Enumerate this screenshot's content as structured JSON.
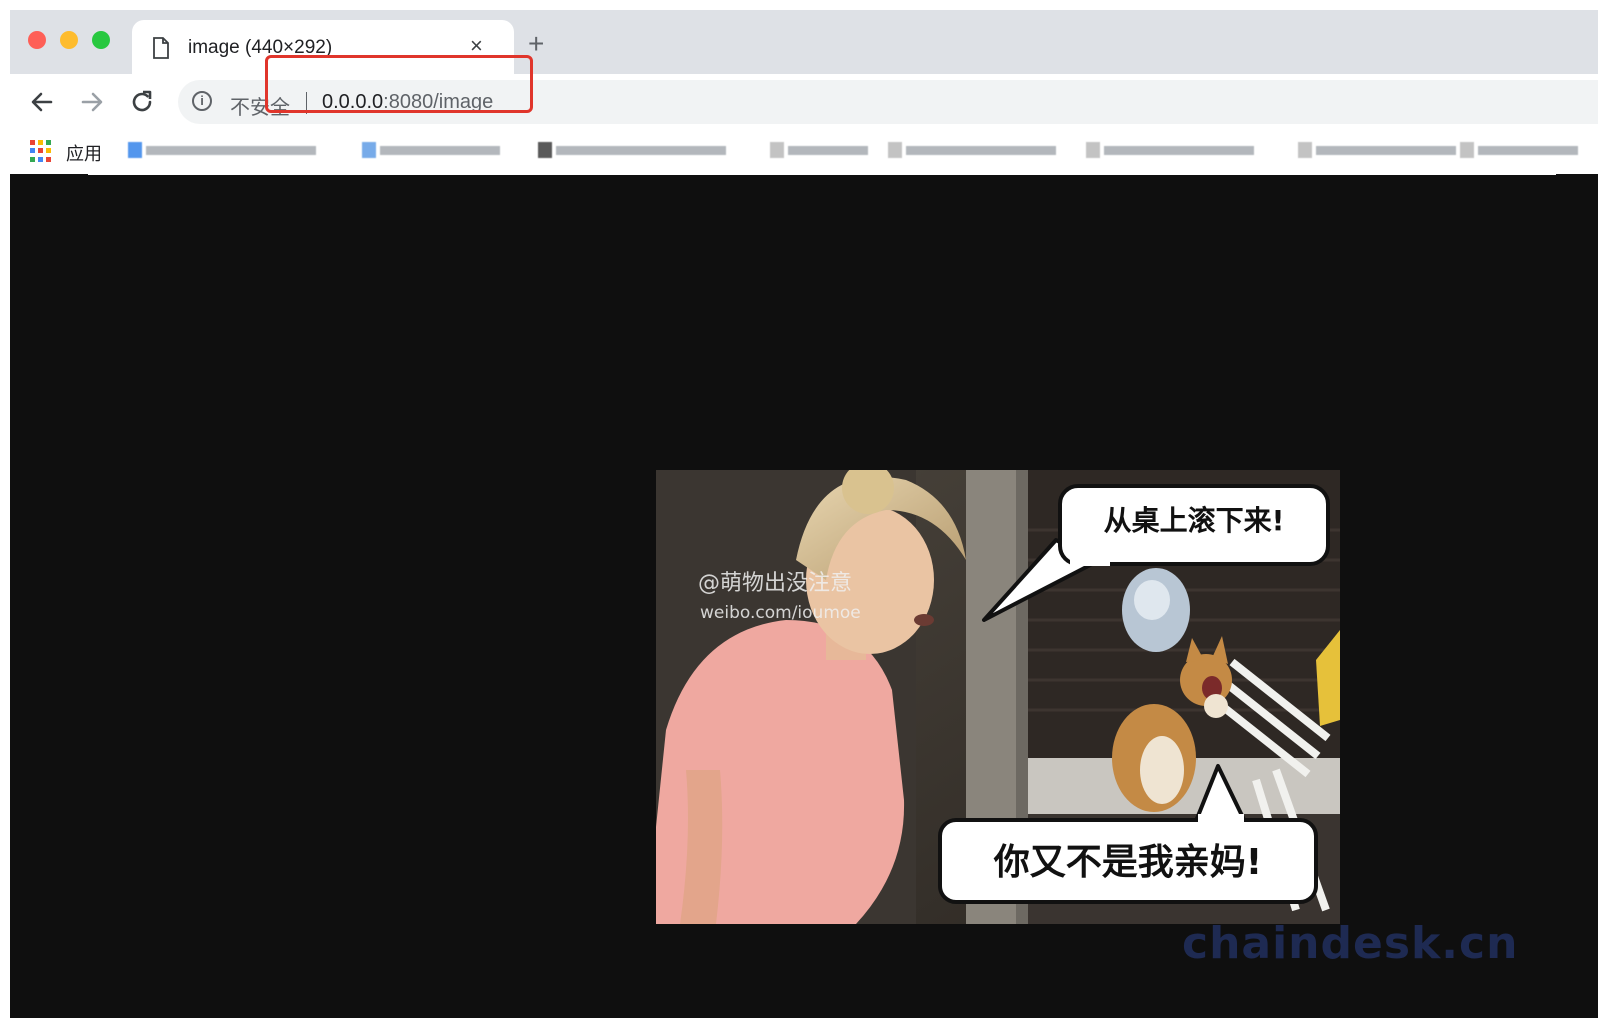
{
  "browser": {
    "tab": {
      "title": "image (440×292)",
      "close_glyph": "×"
    },
    "new_tab_glyph": "+",
    "address_bar": {
      "security_label": "不安全",
      "url_host": "0.0.0.0",
      "url_rest": ":8080/image"
    },
    "bookmarks": {
      "apps_label": "应用"
    },
    "colors": {
      "tab_bar": "#dee1e6",
      "highlight": "#e0352b",
      "page_background": "#0f0f0f"
    }
  },
  "image": {
    "watermark_text": "@萌物出没注意",
    "watermark_url": "weibo.com/ioumoe",
    "bubble_top": "从桌上滚下来!",
    "bubble_bottom": "你又不是我亲妈!"
  },
  "page_watermark": "chaindesk.cn",
  "icons": [
    "page-icon",
    "close-icon",
    "plus-icon",
    "back-arrow-icon",
    "forward-arrow-icon",
    "reload-icon",
    "info-icon",
    "apps-grid-icon"
  ]
}
